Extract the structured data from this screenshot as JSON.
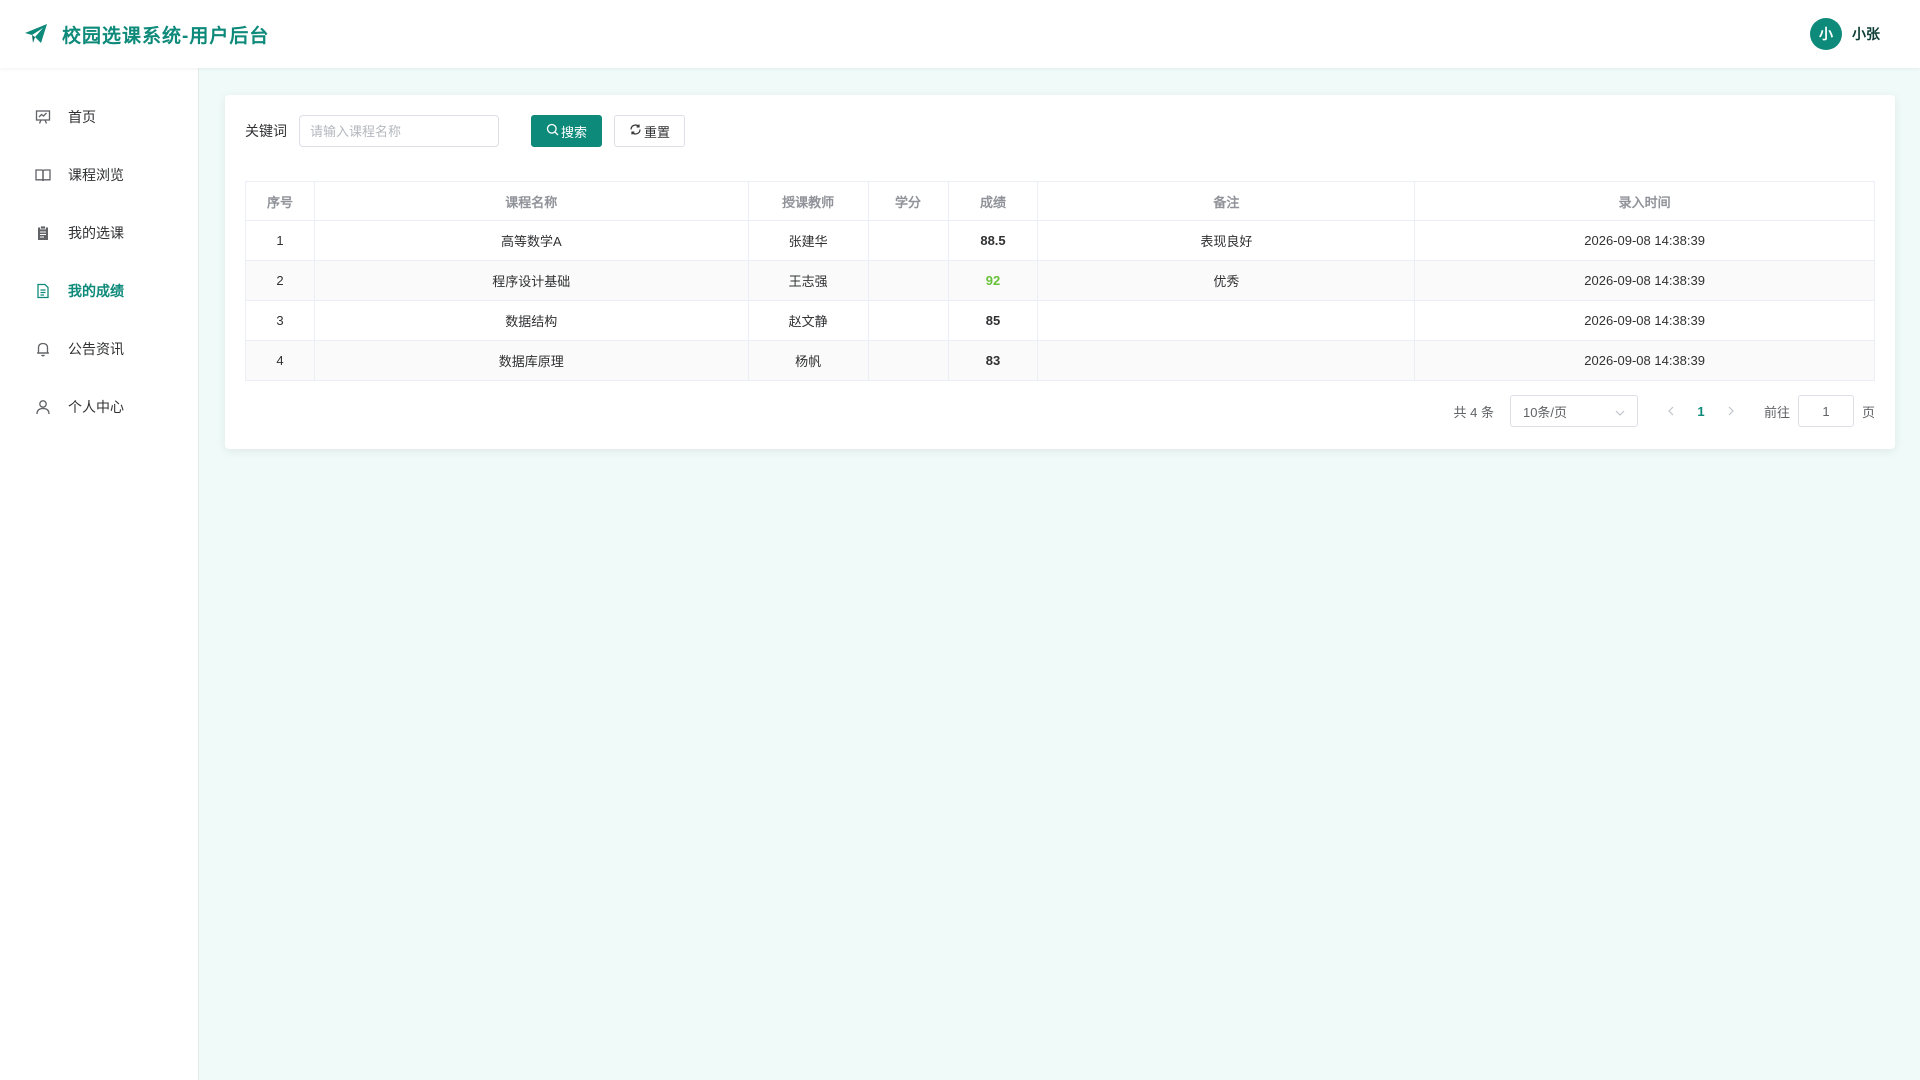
{
  "header": {
    "title": "校园选课系统-用户后台",
    "user": {
      "avatar_text": "小",
      "name": "小张"
    }
  },
  "colors": {
    "accent": "#0e8a7a",
    "score_high": "#67c23a",
    "background": "#f0fbf9"
  },
  "sidebar": {
    "items": [
      {
        "label": "首页",
        "icon": "presentation-icon",
        "active": false
      },
      {
        "label": "课程浏览",
        "icon": "book-icon",
        "active": false
      },
      {
        "label": "我的选课",
        "icon": "clipboard-icon",
        "active": false
      },
      {
        "label": "我的成绩",
        "icon": "document-icon",
        "active": true
      },
      {
        "label": "公告资讯",
        "icon": "bell-icon",
        "active": false
      },
      {
        "label": "个人中心",
        "icon": "user-icon",
        "active": false
      }
    ]
  },
  "search": {
    "label": "关键词",
    "placeholder": "请输入课程名称",
    "value": "",
    "search_label": "搜索",
    "reset_label": "重置"
  },
  "table": {
    "columns": [
      "序号",
      "课程名称",
      "授课教师",
      "学分",
      "成绩",
      "备注",
      "录入时间"
    ],
    "rows": [
      {
        "index": "1",
        "course": "高等数学A",
        "teacher": "张建华",
        "credit": "",
        "score": "88.5",
        "note": "表现良好",
        "time": "2026-09-08 14:38:39"
      },
      {
        "index": "2",
        "course": "程序设计基础",
        "teacher": "王志强",
        "credit": "",
        "score": "92",
        "note": "优秀",
        "time": "2026-09-08 14:38:39"
      },
      {
        "index": "3",
        "course": "数据结构",
        "teacher": "赵文静",
        "credit": "",
        "score": "85",
        "note": "",
        "time": "2026-09-08 14:38:39"
      },
      {
        "index": "4",
        "course": "数据库原理",
        "teacher": "杨帆",
        "credit": "",
        "score": "83",
        "note": "",
        "time": "2026-09-08 14:38:39"
      }
    ]
  },
  "pagination": {
    "total_text": "共 4 条",
    "page_size": "10条/页",
    "current_page": "1",
    "goto_label": "前往",
    "goto_value": "1",
    "goto_suffix": "页"
  }
}
